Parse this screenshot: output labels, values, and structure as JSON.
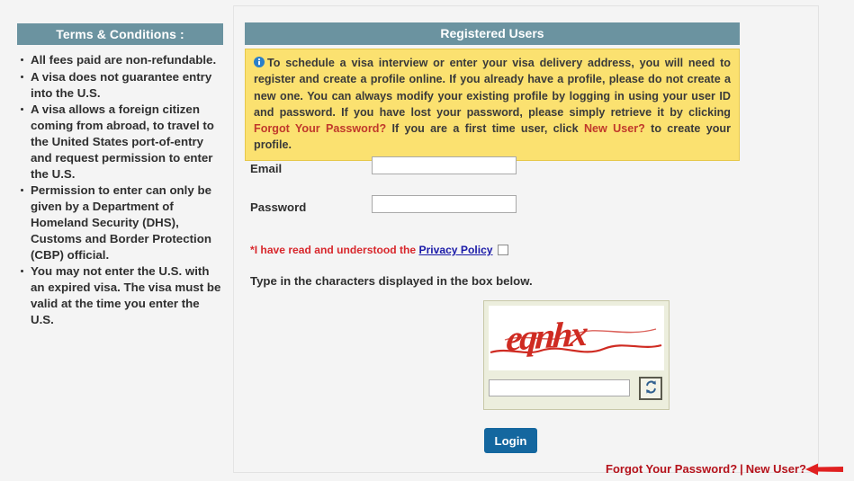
{
  "sidebar": {
    "header": "Terms & Conditions :",
    "items": [
      "All fees paid are non-refundable.",
      "A visa does not guarantee entry into the U.S.",
      "A visa allows a foreign citizen coming from abroad, to travel to the United States port-of-entry and request permission to enter the U.S.",
      "Permission to enter can only be given by a Department of Homeland Security (DHS), Customs and Border Protection (CBP) official.",
      "You may not enter the U.S. with an expired visa. The visa must be valid at the time you enter the U.S."
    ]
  },
  "main": {
    "header": "Registered Users",
    "notice": {
      "icon": "info-icon",
      "part1": "To schedule a visa interview or enter your visa delivery address, you will need to register and create a profile online. If you already have a profile, please do not create a new one. You can always modify your existing profile by logging in using your user ID and password. If you have lost your password, please simply retrieve it by clicking ",
      "highlight1": "Forgot Your Password?",
      "part2": " If you are a first time user, click ",
      "highlight2": "New User?",
      "part3": " to create your profile."
    },
    "form": {
      "email_label": "Email",
      "email_value": "",
      "email_placeholder": "",
      "password_label": "Password",
      "password_value": "",
      "password_placeholder": "",
      "privacy_prefix": "*I have read and understood the ",
      "privacy_link": "Privacy Policy",
      "privacy_checked": false
    },
    "captcha": {
      "instruction": "Type in the characters displayed in the box below.",
      "challenge_text": "eqnhx",
      "input_value": "",
      "input_placeholder": "",
      "refresh_icon": "refresh-icon"
    },
    "login_button": "Login",
    "footer_links": {
      "forgot": "Forgot Your Password?",
      "separator": "|",
      "new_user": "New User?"
    },
    "annotation": "red-arrow-pointing-to-new-user"
  },
  "colors": {
    "header_bar": "#6b93a0",
    "notice_bg": "#fbe170",
    "notice_highlight": "#c0392b",
    "login_button": "#14679f",
    "link_red": "#b5121b",
    "privacy_red": "#d8272c",
    "privacy_link_blue": "#1a1aa8",
    "captcha_text": "#cf2b22",
    "page_bg": "#f4f4f4"
  }
}
